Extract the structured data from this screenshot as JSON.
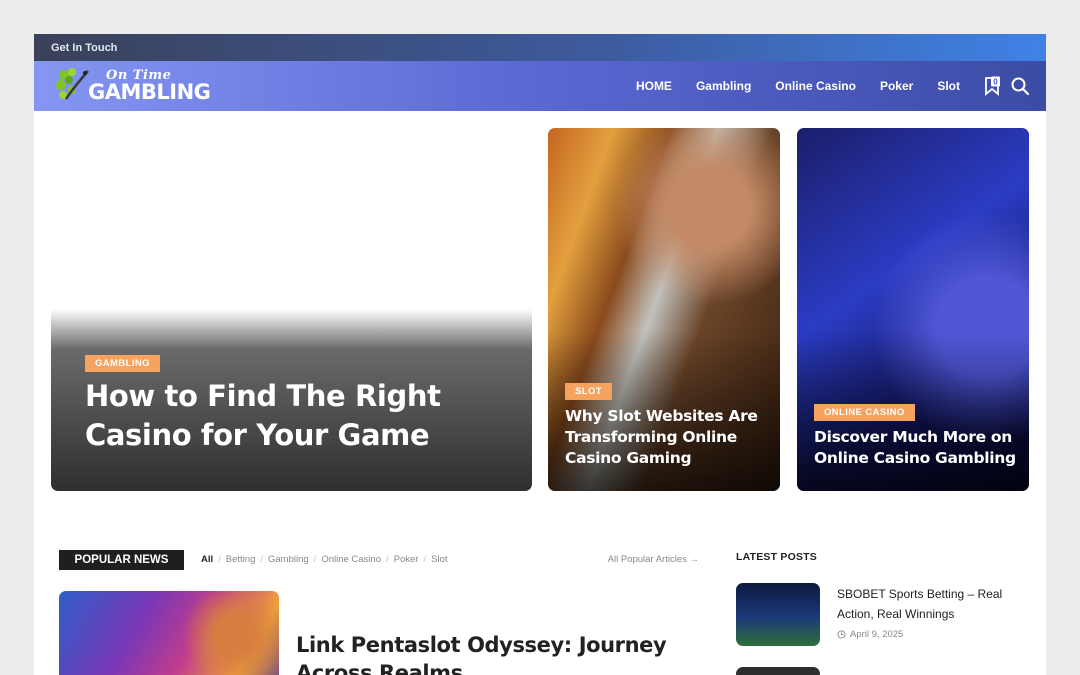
{
  "topbar": {
    "text": "Get In Touch"
  },
  "logo": {
    "line1": "On Time",
    "line2": "GAMBLING"
  },
  "nav": {
    "items": [
      "HOME",
      "Gambling",
      "Online Casino",
      "Poker",
      "Slot"
    ],
    "bookmark_count": "0"
  },
  "hero": {
    "featured": {
      "category": "GAMBLING",
      "title": "How to Find The Right Casino for Your Game"
    },
    "side": [
      {
        "category": "SLOT",
        "title": "Why Slot Websites Are Transforming Online Casino Gaming"
      },
      {
        "category": "ONLINE CASINO",
        "title": "Discover Much More on Online Casino Gambling"
      }
    ]
  },
  "popular": {
    "heading": "POPULAR NEWS",
    "filters": [
      "All",
      "Betting",
      "Gambling",
      "Online Casino",
      "Poker",
      "Slot"
    ],
    "all_link": "All Popular Articles →",
    "first_post_title": "Link Pentaslot Odyssey: Journey Across Realms"
  },
  "latest": {
    "heading": "LATEST POSTS",
    "posts": [
      {
        "title": "SBOBET Sports Betting – Real Action, Real Winnings",
        "date": "April 9, 2025"
      }
    ]
  },
  "colors": {
    "tag": "#f5a35e",
    "nav_start": "#8596f2",
    "nav_end": "#3c4ca5"
  }
}
